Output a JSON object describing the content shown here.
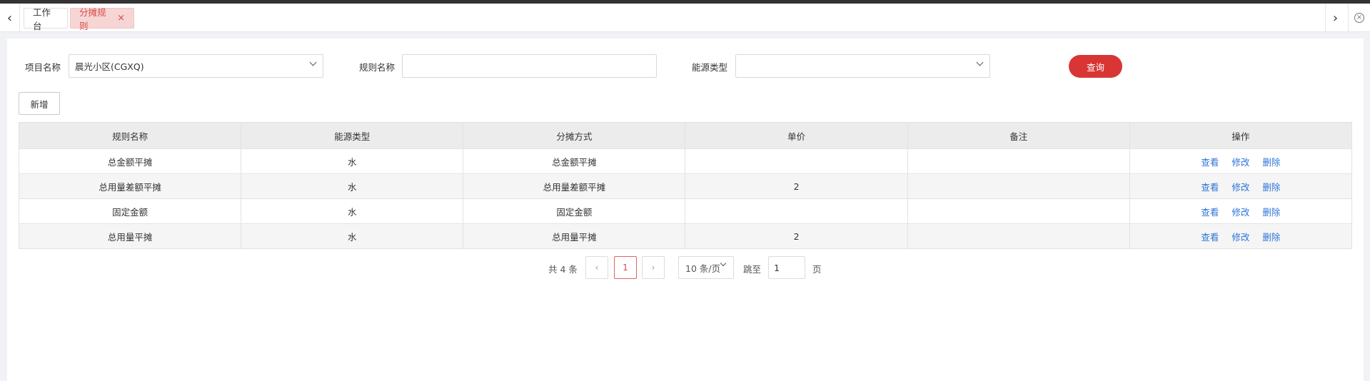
{
  "tabs": [
    {
      "label": "工作台",
      "active": false
    },
    {
      "label": "分摊规则",
      "active": true,
      "close": "×"
    }
  ],
  "filters": {
    "project_label": "项目名称",
    "project_value": "晨光小区(CGXQ)",
    "rule_label": "规则名称",
    "rule_value": "",
    "energy_label": "能源类型",
    "energy_value": "",
    "query_label": "查询"
  },
  "toolbar": {
    "add_label": "新增"
  },
  "table": {
    "headers": [
      "规则名称",
      "能源类型",
      "分摊方式",
      "单价",
      "备注",
      "操作"
    ],
    "rows": [
      [
        "总金额平摊",
        "水",
        "总金额平摊",
        "",
        ""
      ],
      [
        "总用量差额平摊",
        "水",
        "总用量差额平摊",
        "2",
        ""
      ],
      [
        "固定金额",
        "水",
        "固定金额",
        "",
        ""
      ],
      [
        "总用量平摊",
        "水",
        "总用量平摊",
        "2",
        ""
      ]
    ],
    "actions": [
      "查看",
      "修改",
      "删除"
    ]
  },
  "pagination": {
    "total_text": "共 4 条",
    "current_page": "1",
    "page_size": "10 条/页",
    "jump_label": "跳至",
    "jump_value": "1",
    "page_suffix": "页"
  },
  "colors": {
    "accent": "#d93535",
    "link": "#2e74d8",
    "active_tab_bg": "#f7d5d5"
  }
}
